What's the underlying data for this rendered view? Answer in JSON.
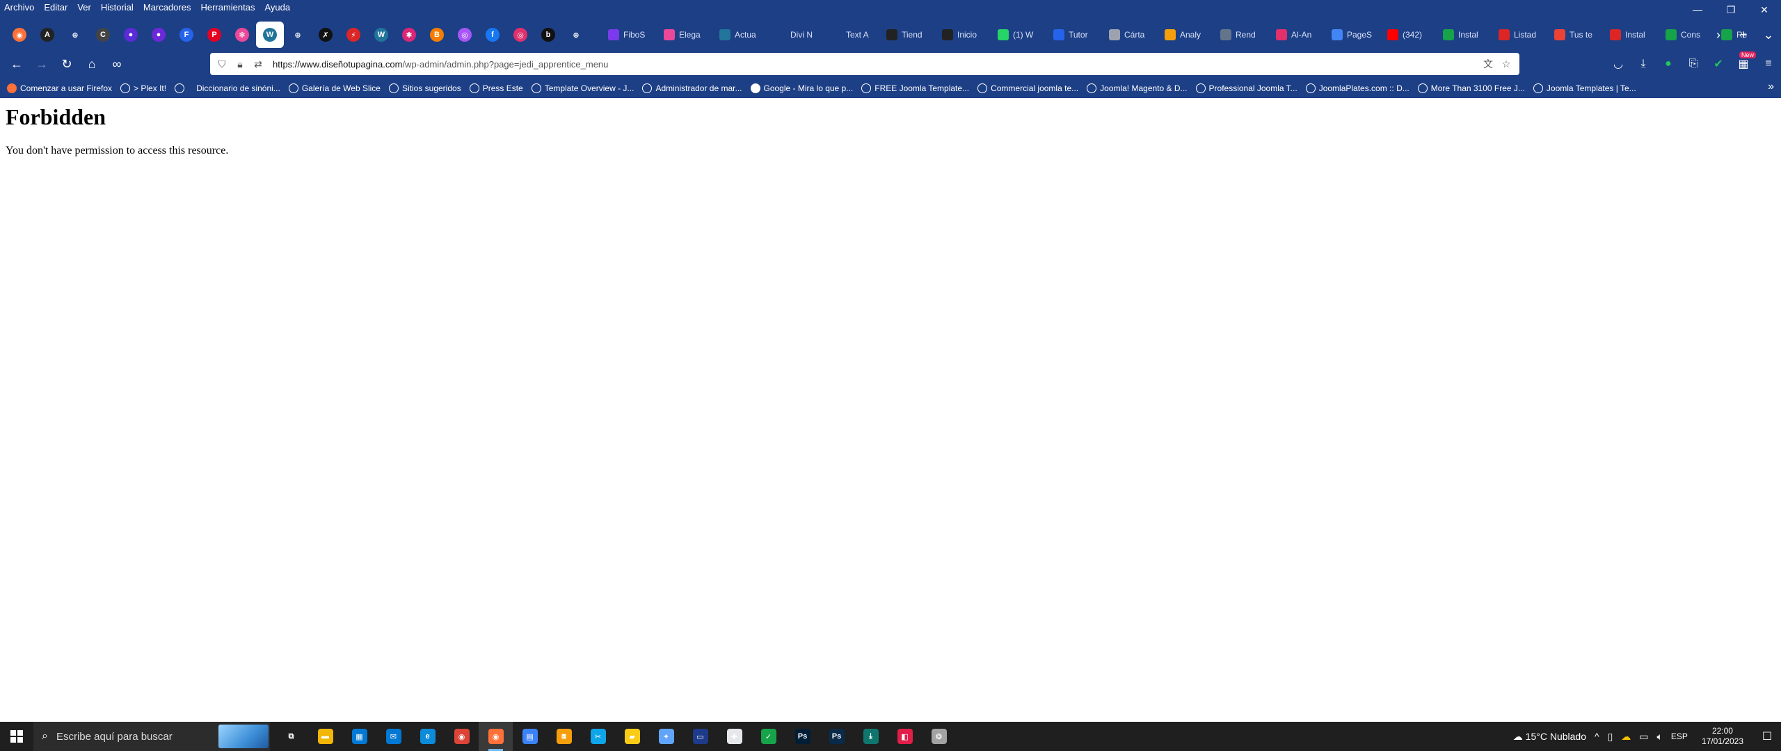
{
  "menubar": {
    "items": [
      "Archivo",
      "Editar",
      "Ver",
      "Historial",
      "Marcadores",
      "Herramientas",
      "Ayuda"
    ]
  },
  "window_controls": {
    "minimize": "—",
    "restore": "❐",
    "close": "✕"
  },
  "pinned_tabs": [
    {
      "icon": "firefox-view-icon",
      "glyph": "◉",
      "color": "#ff7139"
    },
    {
      "icon": "a-logo-icon",
      "glyph": "A",
      "color": "#222222"
    },
    {
      "icon": "globe-icon",
      "glyph": "⊕",
      "color": "#1d3f86"
    },
    {
      "icon": "c-logo-icon",
      "glyph": "C",
      "color": "#444444"
    },
    {
      "icon": "purple-circle-icon",
      "glyph": "●",
      "color": "#5b2bd6"
    },
    {
      "icon": "purple-circle-icon",
      "glyph": "●",
      "color": "#6d28d9"
    },
    {
      "icon": "f-logo-icon",
      "glyph": "F",
      "color": "#2563eb"
    },
    {
      "icon": "pinterest-icon",
      "glyph": "P",
      "color": "#e60023"
    },
    {
      "icon": "flower-icon",
      "glyph": "✻",
      "color": "#ec4899"
    },
    {
      "icon": "wordpress-icon",
      "glyph": "W",
      "color": "#21759b"
    },
    {
      "icon": "globe-icon",
      "glyph": "⊕",
      "color": "#1d3f86"
    },
    {
      "icon": "x-logo-icon",
      "glyph": "✗",
      "color": "#111111"
    },
    {
      "icon": "bolt-icon",
      "glyph": "⚡",
      "color": "#dc2626"
    },
    {
      "icon": "wordpress-icon",
      "glyph": "W",
      "color": "#21759b"
    },
    {
      "icon": "asterisk-icon",
      "glyph": "✱",
      "color": "#db2777"
    },
    {
      "icon": "blogger-icon",
      "glyph": "B",
      "color": "#f57d00"
    },
    {
      "icon": "chart-icon",
      "glyph": "◎",
      "color": "#a855f7"
    },
    {
      "icon": "facebook-icon",
      "glyph": "f",
      "color": "#1877f2"
    },
    {
      "icon": "instagram-icon",
      "glyph": "◎",
      "color": "#e1306c"
    },
    {
      "icon": "b-logo-icon",
      "glyph": "b",
      "color": "#111111"
    },
    {
      "icon": "globe-icon",
      "glyph": "⊕",
      "color": "#1d3f86"
    }
  ],
  "tabs": [
    {
      "label": "FiboS",
      "icon": "fibo-icon",
      "color": "#7c3aed"
    },
    {
      "label": "Elega",
      "icon": "elegant-icon",
      "color": "#ec4899"
    },
    {
      "label": "Actua",
      "icon": "wordpress-icon",
      "color": "#21759b"
    },
    {
      "label": "Divi N",
      "icon": "x-icon",
      "color": "#1d3f86"
    },
    {
      "label": "Text A",
      "icon": "x-icon",
      "color": "#1d3f86"
    },
    {
      "label": "Tiend",
      "icon": "a-logo-icon",
      "color": "#222222"
    },
    {
      "label": "Inicio",
      "icon": "a-logo-icon",
      "color": "#222222"
    },
    {
      "label": "(1) W",
      "icon": "whatsapp-icon",
      "color": "#25d366"
    },
    {
      "label": "Tutor",
      "icon": "d-logo-icon",
      "color": "#2563eb"
    },
    {
      "label": "Cárta",
      "icon": "image-icon",
      "color": "#9ca3af"
    },
    {
      "label": "Analy",
      "icon": "analytics-icon",
      "color": "#f59e0b"
    },
    {
      "label": "Rend",
      "icon": "printer-icon",
      "color": "#64748b"
    },
    {
      "label": "Al-An",
      "icon": "instagram-icon",
      "color": "#e1306c"
    },
    {
      "label": "PageS",
      "icon": "pagespeed-icon",
      "color": "#4285f4"
    },
    {
      "label": "(342)",
      "icon": "youtube-icon",
      "color": "#ff0000"
    },
    {
      "label": "Instal",
      "icon": "circle-icon",
      "color": "#16a34a"
    },
    {
      "label": "Listad",
      "icon": "list-icon",
      "color": "#dc2626"
    },
    {
      "label": "Tus te",
      "icon": "gmail-icon",
      "color": "#ea4335"
    },
    {
      "label": "Instal",
      "icon": "circle-icon",
      "color": "#dc2626"
    },
    {
      "label": "Cons",
      "icon": "circle-icon",
      "color": "#16a34a"
    },
    {
      "label": "Re",
      "icon": "circle-icon",
      "color": "#16a34a"
    }
  ],
  "tab_controls": {
    "scroll_right": "›",
    "new_tab": "+",
    "list_all": "⌄"
  },
  "nav": {
    "back": "←",
    "forward": "→",
    "reload": "↻",
    "home": "⌂",
    "extension": "∞"
  },
  "urlbar": {
    "host": "https://www.diseñotupagina.com",
    "path": "/wp-admin/admin.php?page=jedi_apprentice_menu",
    "translate_icon": "文",
    "star_icon": "☆"
  },
  "nav_right": {
    "new_badge": "New"
  },
  "bookmarks": [
    {
      "label": "Comenzar a usar Firefox",
      "type": "fx"
    },
    {
      "label": "> Plex It!",
      "type": "globe"
    },
    {
      "label": "",
      "type": "globe"
    },
    {
      "label": "Diccionario de sinóni...",
      "type": "none"
    },
    {
      "label": "Galería de Web Slice",
      "type": "globe"
    },
    {
      "label": "Sitios sugeridos",
      "type": "globe"
    },
    {
      "label": "Press Este",
      "type": "globe"
    },
    {
      "label": "Template Overview - J...",
      "type": "globe"
    },
    {
      "label": "Administrador de mar...",
      "type": "globe"
    },
    {
      "label": "Google - Mira lo que p...",
      "type": "g"
    },
    {
      "label": "FREE Joomla Template...",
      "type": "globe"
    },
    {
      "label": "Commercial joomla te...",
      "type": "globe"
    },
    {
      "label": "Joomla! Magento & D...",
      "type": "globe"
    },
    {
      "label": "Professional Joomla T...",
      "type": "globe"
    },
    {
      "label": "JoomlaPlates.com :: D...",
      "type": "globe"
    },
    {
      "label": "More Than 3100 Free J...",
      "type": "globe"
    },
    {
      "label": "Joomla Templates | Te...",
      "type": "globe"
    }
  ],
  "bookmarks_more": "»",
  "page": {
    "heading": "Forbidden",
    "message": "You don't have permission to access this resource."
  },
  "taskbar": {
    "search_placeholder": "Escribe aquí para buscar",
    "apps": [
      {
        "name": "task-view-icon",
        "glyph": "⧉",
        "color": "#1f1f1f"
      },
      {
        "name": "file-explorer-icon",
        "glyph": "▬",
        "color": "#f2b705"
      },
      {
        "name": "store-icon",
        "glyph": "▦",
        "color": "#0078d4"
      },
      {
        "name": "mail-icon",
        "glyph": "✉",
        "color": "#0078d4"
      },
      {
        "name": "edge-icon",
        "glyph": "e",
        "color": "#0c8bd8"
      },
      {
        "name": "chrome-icon",
        "glyph": "◉",
        "color": "#db4437"
      },
      {
        "name": "firefox-icon",
        "glyph": "◉",
        "color": "#ff7139",
        "active": true
      },
      {
        "name": "app-icon",
        "glyph": "▤",
        "color": "#3b82f6"
      },
      {
        "name": "app-icon",
        "glyph": "⧈",
        "color": "#f59e0b"
      },
      {
        "name": "snipping-icon",
        "glyph": "✂",
        "color": "#0ea5e9"
      },
      {
        "name": "sticky-notes-icon",
        "glyph": "▰",
        "color": "#facc15"
      },
      {
        "name": "app-icon",
        "glyph": "✦",
        "color": "#60a5fa"
      },
      {
        "name": "app-icon",
        "glyph": "▭",
        "color": "#1e3a8a"
      },
      {
        "name": "app-icon",
        "glyph": "✚",
        "color": "#e5e7eb"
      },
      {
        "name": "app-icon",
        "glyph": "✓",
        "color": "#16a34a"
      },
      {
        "name": "photoshop-icon",
        "glyph": "Ps",
        "color": "#001e36"
      },
      {
        "name": "photoshop-icon",
        "glyph": "Ps",
        "color": "#0a2a4a"
      },
      {
        "name": "app-icon",
        "glyph": "⤓",
        "color": "#0f766e"
      },
      {
        "name": "app-icon",
        "glyph": "◧",
        "color": "#e11d48"
      },
      {
        "name": "app-icon",
        "glyph": "❂",
        "color": "#a3a3a3"
      }
    ],
    "weather": "15°C  Nublado",
    "tray_chevron": "^",
    "language": "ESP",
    "time": "22:00",
    "date": "17/01/2023",
    "notifications": "☐"
  }
}
